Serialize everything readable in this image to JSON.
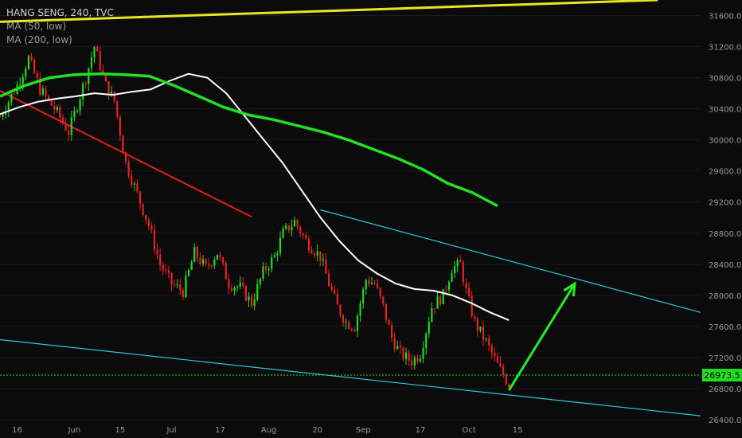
{
  "chart_data": {
    "type": "candlestick",
    "title": "HANG SENG, 240, TVC",
    "ylim": [
      26400,
      31800
    ],
    "y_ticks": [
      26400,
      26800,
      27200,
      27600,
      28000,
      28400,
      28800,
      29200,
      29600,
      30000,
      30400,
      30800,
      31200,
      31600
    ],
    "x_tick_labels": [
      "16",
      "Jun",
      "15",
      "Jul",
      "17",
      "Aug",
      "20",
      "Sep",
      "17",
      "Oct",
      "15"
    ],
    "last_price": 26973.5,
    "indicators": [
      {
        "name": "MA (50, low)",
        "color": "#ffffff"
      },
      {
        "name": "MA (200, low)",
        "color": "#22e022"
      }
    ],
    "colors": {
      "up": "#22dd22",
      "down": "#ee2222",
      "background": "#0b0b0b",
      "channel": "#2ec7d8",
      "resistance": "#e8e822",
      "support": "#e02020",
      "grid": "#1a1a1a"
    },
    "series": [
      {
        "name": "MA (50, low)",
        "values": [
          30330,
          30420,
          30490,
          30530,
          30560,
          30600,
          30580,
          30620,
          30650,
          30760,
          30850,
          30800,
          30600,
          30300,
          30000,
          29700,
          29350,
          29000,
          28700,
          28450,
          28280,
          28150,
          28080,
          28060,
          28000,
          27900,
          27780,
          27680
        ]
      },
      {
        "name": "MA (200, low)",
        "values": [
          30560,
          30700,
          30800,
          30840,
          30850,
          30840,
          30820,
          30700,
          30560,
          30420,
          30320,
          30260,
          30180,
          30100,
          30000,
          29880,
          29760,
          29620,
          29440,
          29320,
          29150
        ]
      }
    ],
    "trendlines": [
      {
        "name": "resistance",
        "points": [
          [
            0,
            31520
          ],
          [
            230,
            31800
          ]
        ]
      },
      {
        "name": "downtrend",
        "points": [
          [
            0,
            30630
          ],
          [
            88,
            29010
          ]
        ]
      },
      {
        "name": "channel-top",
        "points": [
          [
            112,
            29100
          ],
          [
            245,
            27780
          ]
        ]
      },
      {
        "name": "channel-bottom",
        "points": [
          [
            0,
            27430
          ],
          [
            245,
            26450
          ]
        ]
      }
    ]
  }
}
